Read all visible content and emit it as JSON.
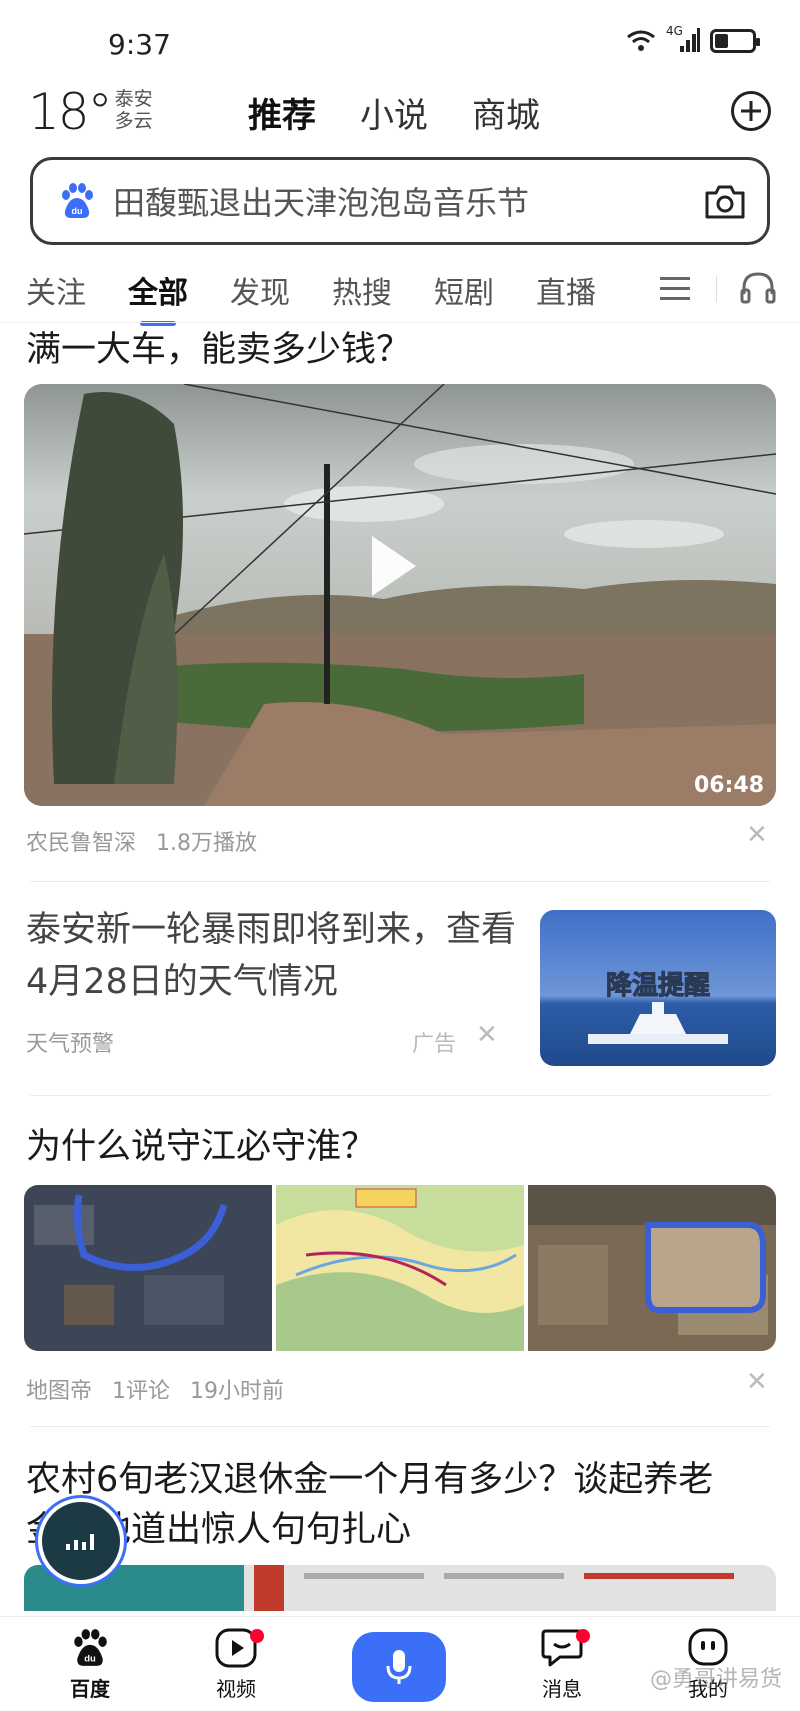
{
  "status_bar": {
    "time": "9:37",
    "network": "4G",
    "battery_level": 0.35
  },
  "weather": {
    "temp": "18°",
    "city": "泰安",
    "condition": "多云"
  },
  "top_tabs": [
    {
      "label": "推荐",
      "active": true
    },
    {
      "label": "小说",
      "active": false
    },
    {
      "label": "商城",
      "active": false
    }
  ],
  "search": {
    "placeholder": "田馥甄退出天津泡泡岛音乐节"
  },
  "channel_tabs": [
    {
      "label": "关注",
      "active": false
    },
    {
      "label": "全部",
      "active": true
    },
    {
      "label": "发现",
      "active": false
    },
    {
      "label": "热搜",
      "active": false
    },
    {
      "label": "短剧",
      "active": false
    },
    {
      "label": "直播",
      "active": false
    }
  ],
  "feed": {
    "item1": {
      "title": "满一大车，能卖多少钱？",
      "duration": "06:48",
      "author": "农民鲁智深",
      "plays": "1.8万播放"
    },
    "item2": {
      "title": "泰安新一轮暴雨即将到来，查看4月28日的天气情况",
      "source": "天气预警",
      "ad_label": "广告",
      "thumb_text": "降温提醒"
    },
    "item3": {
      "title": "为什么说守江必守淮？",
      "author": "地图帝",
      "comments": "1评论",
      "time": "19小时前"
    },
    "item4": {
      "title": "农村6旬老汉退休金一个月有多少？谈起养老金，他道出惊人句句扎心"
    }
  },
  "bottom_nav": {
    "home": "百度",
    "video": "视频",
    "messages": "消息",
    "mine": "我的"
  },
  "watermark": "@勇哥讲易货",
  "colors": {
    "accent": "#3c6ff7",
    "badge": "#ff0033"
  }
}
